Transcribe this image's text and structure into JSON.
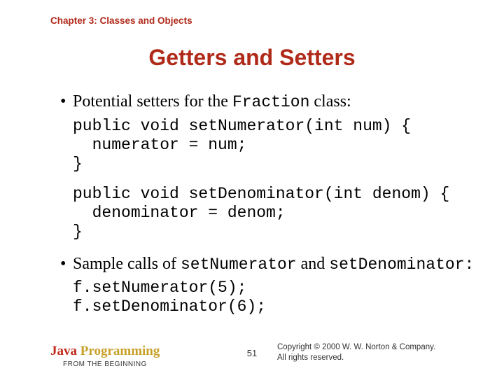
{
  "chapter": "Chapter 3: Classes and Objects",
  "title": "Getters and Setters",
  "bullets": {
    "b0_pre": "Potential setters for the ",
    "b0_code": "Fraction",
    "b0_post": " class:",
    "b1_pre": "Sample calls of ",
    "b1_code1": "setNumerator",
    "b1_mid": " and ",
    "b1_code2": "setDenominator",
    "b1_post": ":"
  },
  "code": {
    "block1": "public void setNumerator(int num) {\n  numerator = num;\n}",
    "block2": "public void setDenominator(int denom) {\n  denominator = denom;\n}",
    "block3": "f.setNumerator(5);\nf.setDenominator(6);"
  },
  "footer": {
    "brand_java": "Java",
    "brand_prog": " Programming",
    "brand_sub": "FROM THE BEGINNING",
    "page": "51",
    "copyright_l1": "Copyright © 2000 W. W. Norton & Company.",
    "copyright_l2": "All rights reserved."
  }
}
